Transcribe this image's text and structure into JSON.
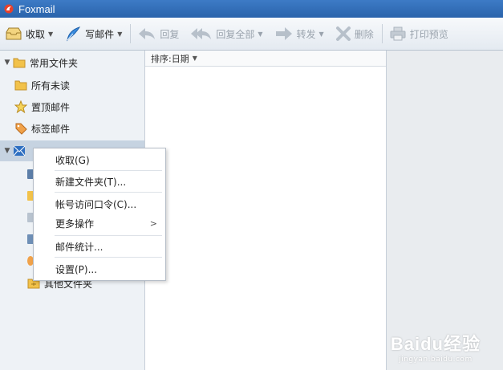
{
  "window": {
    "title": "Foxmail"
  },
  "toolbar": {
    "receive": "收取",
    "compose": "写邮件",
    "reply": "回复",
    "reply_all": "回复全部",
    "forward": "转发",
    "delete": "删除",
    "print_preview": "打印预览"
  },
  "folders": {
    "common_group": "常用文件夹",
    "all_unread": "所有未读",
    "pinned": "置顶邮件",
    "tagged": "标签邮件",
    "other": "其他文件夹"
  },
  "list": {
    "sort_label": "排序:日期"
  },
  "context_menu": {
    "items": [
      "收取(G)",
      "新建文件夹(T)...",
      "帐号访问口令(C)...",
      "更多操作",
      "邮件统计...",
      "设置(P)..."
    ]
  },
  "watermark": {
    "main": "Baidu经验",
    "sub": "jingyan.baidu.com"
  },
  "colors": {
    "titlebar": "#2f6db5",
    "folder_yellow": "#f2c24a",
    "selection": "#c6d3e1"
  }
}
